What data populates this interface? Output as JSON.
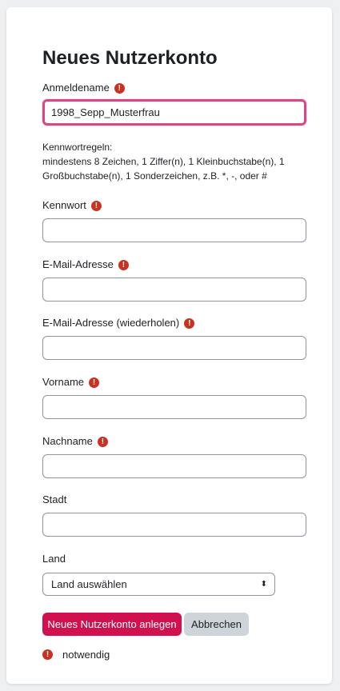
{
  "form": {
    "title": "Neues Nutzerkonto",
    "required_icon": "exclamation-circle-icon",
    "required_symbol": "!",
    "username": {
      "label": "Anmeldename",
      "value": "1998_Sepp_Musterfrau"
    },
    "password_rules": {
      "heading": "Kennwortregeln:",
      "text": "mindestens 8 Zeichen, 1 Ziffer(n), 1 Kleinbuchstabe(n), 1 Großbuchstabe(n), 1 Sonderzeichen, z.B. *, -, oder #"
    },
    "password": {
      "label": "Kennwort",
      "value": ""
    },
    "email": {
      "label": "E-Mail-Adresse",
      "value": ""
    },
    "email_repeat": {
      "label": "E-Mail-Adresse (wiederholen)",
      "value": ""
    },
    "firstname": {
      "label": "Vorname",
      "value": ""
    },
    "lastname": {
      "label": "Nachname",
      "value": ""
    },
    "city": {
      "label": "Stadt",
      "value": ""
    },
    "country": {
      "label": "Land",
      "selected": "Land auswählen",
      "arrows": "⬍"
    },
    "buttons": {
      "submit": "Neues Nutzerkonto anlegen",
      "cancel": "Abbrechen"
    },
    "legend": "notwendig"
  },
  "colors": {
    "primary": "#d1114f",
    "required": "#ca3120",
    "focus_border": "#d94785"
  }
}
